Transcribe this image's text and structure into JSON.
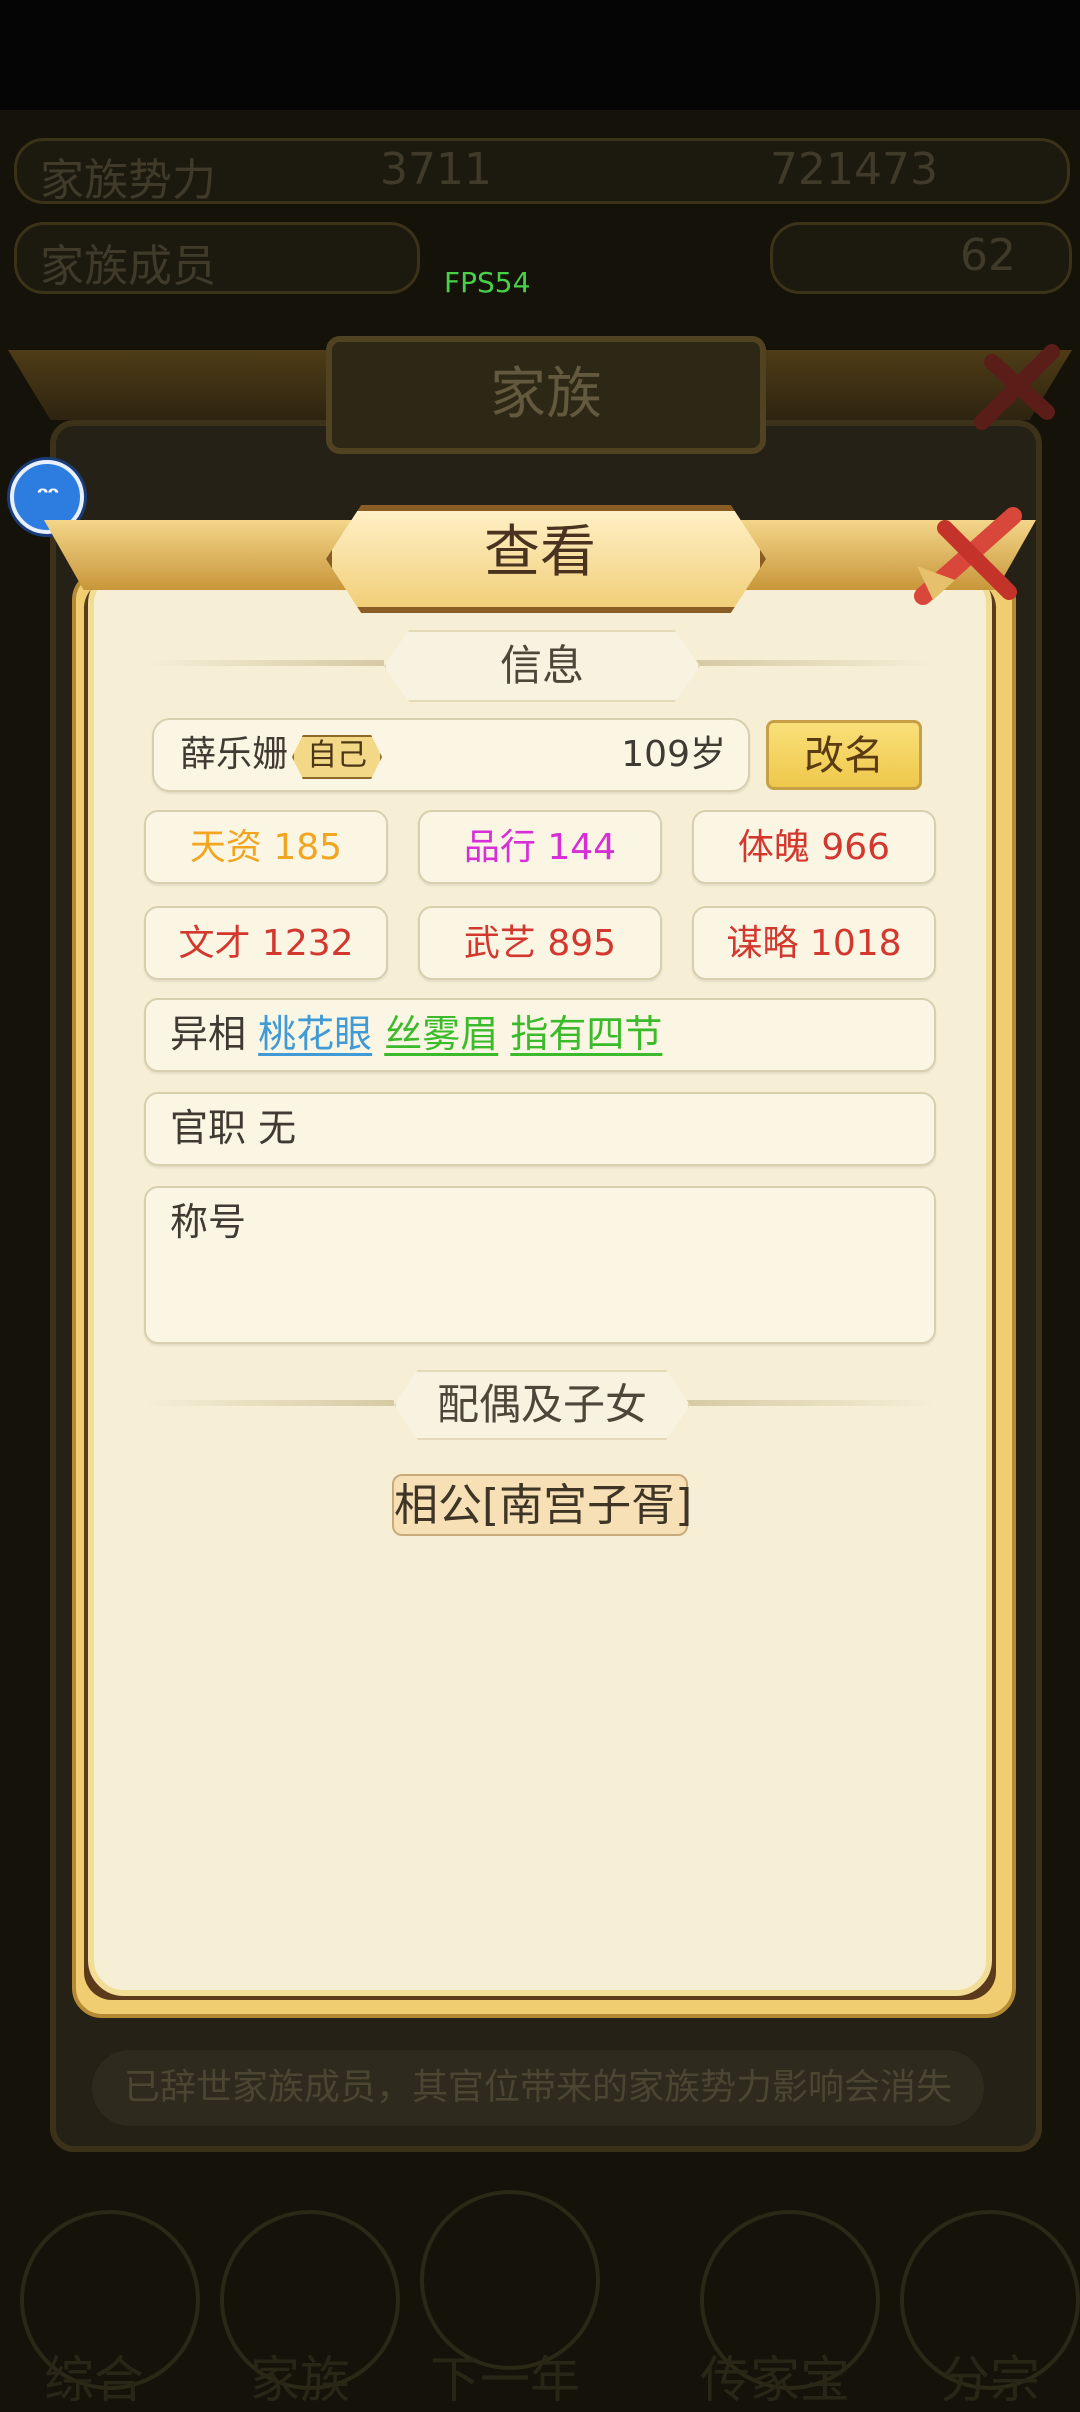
{
  "fps": "FPS54",
  "background": {
    "top_left": "家族势力",
    "top_mid": "3711",
    "top_right": "721473",
    "row2_left": "家族成员",
    "row2_right": "62",
    "family_title": "家族",
    "footer_notice": "已辞世家族成员，其官位带来的家族势力影响会消失",
    "nav": [
      "综合",
      "家族",
      "下一年",
      "传家宝",
      "分宗"
    ]
  },
  "dialog": {
    "title": "查看",
    "info_header": "信息",
    "member": {
      "name": "薛乐姗",
      "self_badge": "自己",
      "age": "109岁",
      "rename_label": "改名"
    },
    "stats": [
      {
        "label": "天资 185",
        "color": "#f2a520"
      },
      {
        "label": "品行 144",
        "color": "#d72fd7"
      },
      {
        "label": "体魄 966",
        "color": "#d2382e"
      },
      {
        "label": "文才 1232",
        "color": "#d2382e"
      },
      {
        "label": "武艺 895",
        "color": "#d2382e"
      },
      {
        "label": "谋略 1018",
        "color": "#d2382e"
      }
    ],
    "traits_label": "异相",
    "traits": [
      {
        "name": "桃花眼",
        "color": "#3f9ad6"
      },
      {
        "name": "丝雾眉",
        "color": "#3bbb2b"
      },
      {
        "name": "指有四节",
        "color": "#3bbb2b"
      }
    ],
    "office": "官职 无",
    "title_label": "称号",
    "spouse_header": "配偶及子女",
    "spouse": "相公[南宫子胥]"
  }
}
